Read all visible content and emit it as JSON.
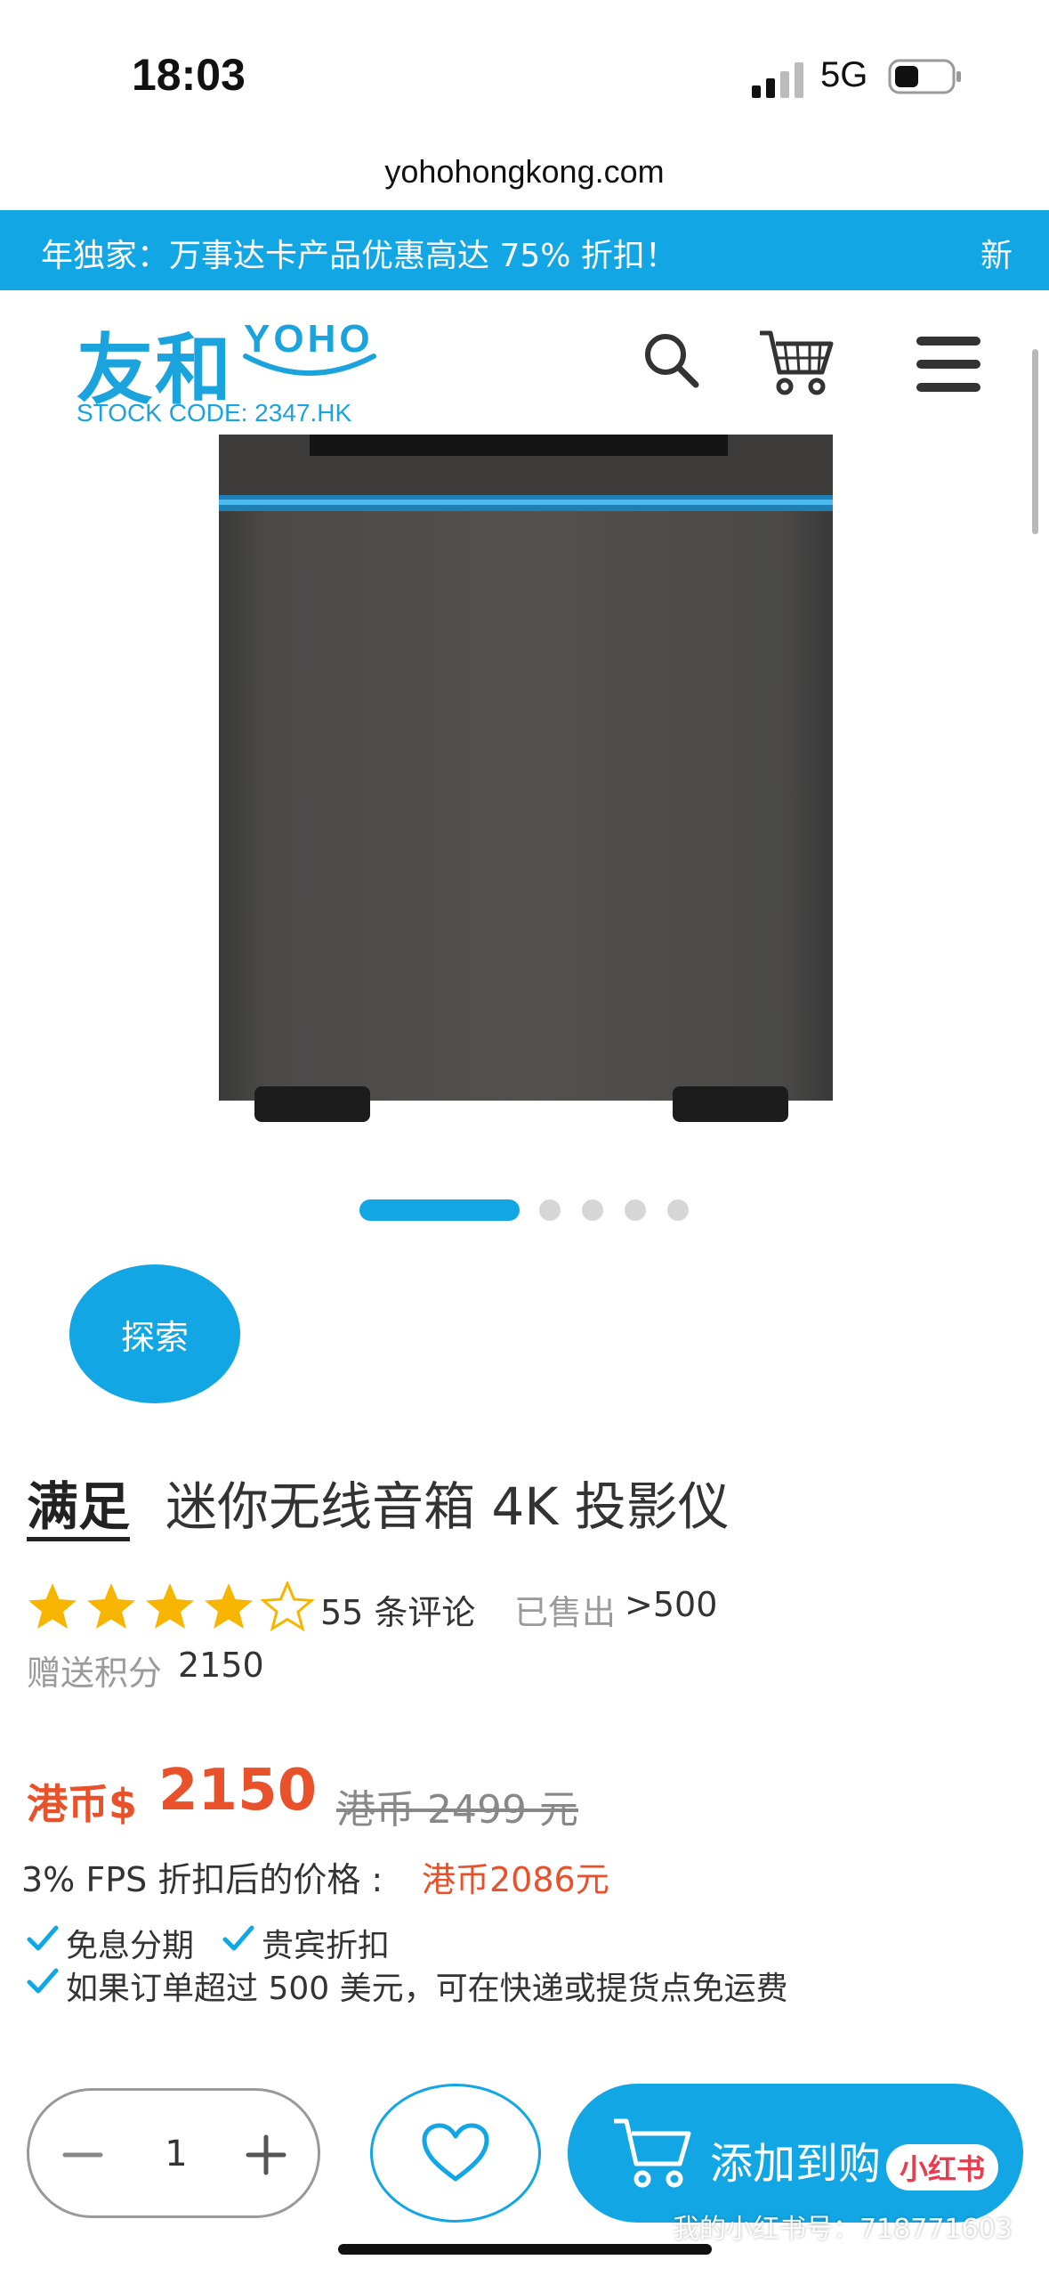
{
  "status_bar": {
    "time": "18:03",
    "network": "5G"
  },
  "browser": {
    "url": "yohohongkong.com"
  },
  "promo": {
    "text": "年独家：万事达卡产品优惠高达 75% 折扣！",
    "new_label": "新"
  },
  "header": {
    "logo_zh": "友和",
    "logo_en": "YOHO",
    "stock_code": "STOCK CODE: 2347.HK"
  },
  "carousel": {
    "total": 5,
    "active": 1
  },
  "explore_label": "探索",
  "product": {
    "brand": "满足",
    "name": "迷你无线音箱 4K 投影仪",
    "rating": 4.5,
    "reviews": "55 条评论",
    "sold_label": "已售出",
    "sold_value": ">500",
    "points_label": "赠送积分",
    "points_value": "2150",
    "price_prefix": "港币$",
    "price": "2150",
    "original_price": "港币 2499 元",
    "fps_label": "3% FPS 折扣后的价格 :",
    "fps_price": "港币2086元",
    "features": [
      "免息分期",
      "贵宾折扣",
      "如果订单超过 500 美元，可在快递或提货点免运费"
    ]
  },
  "cart_bar": {
    "quantity": "1",
    "add_to_cart": "添加到购",
    "xhs_badge": "小红书",
    "xhs_id": "我的小红书号：718771603"
  },
  "colors": {
    "accent": "#12a6e4",
    "price": "#e8512a",
    "star": "#f7b500"
  },
  "icons": [
    "search-icon",
    "cart-icon",
    "hamburger-menu-icon",
    "heart-icon",
    "minus-icon",
    "plus-icon",
    "check-icon",
    "star-icon"
  ]
}
